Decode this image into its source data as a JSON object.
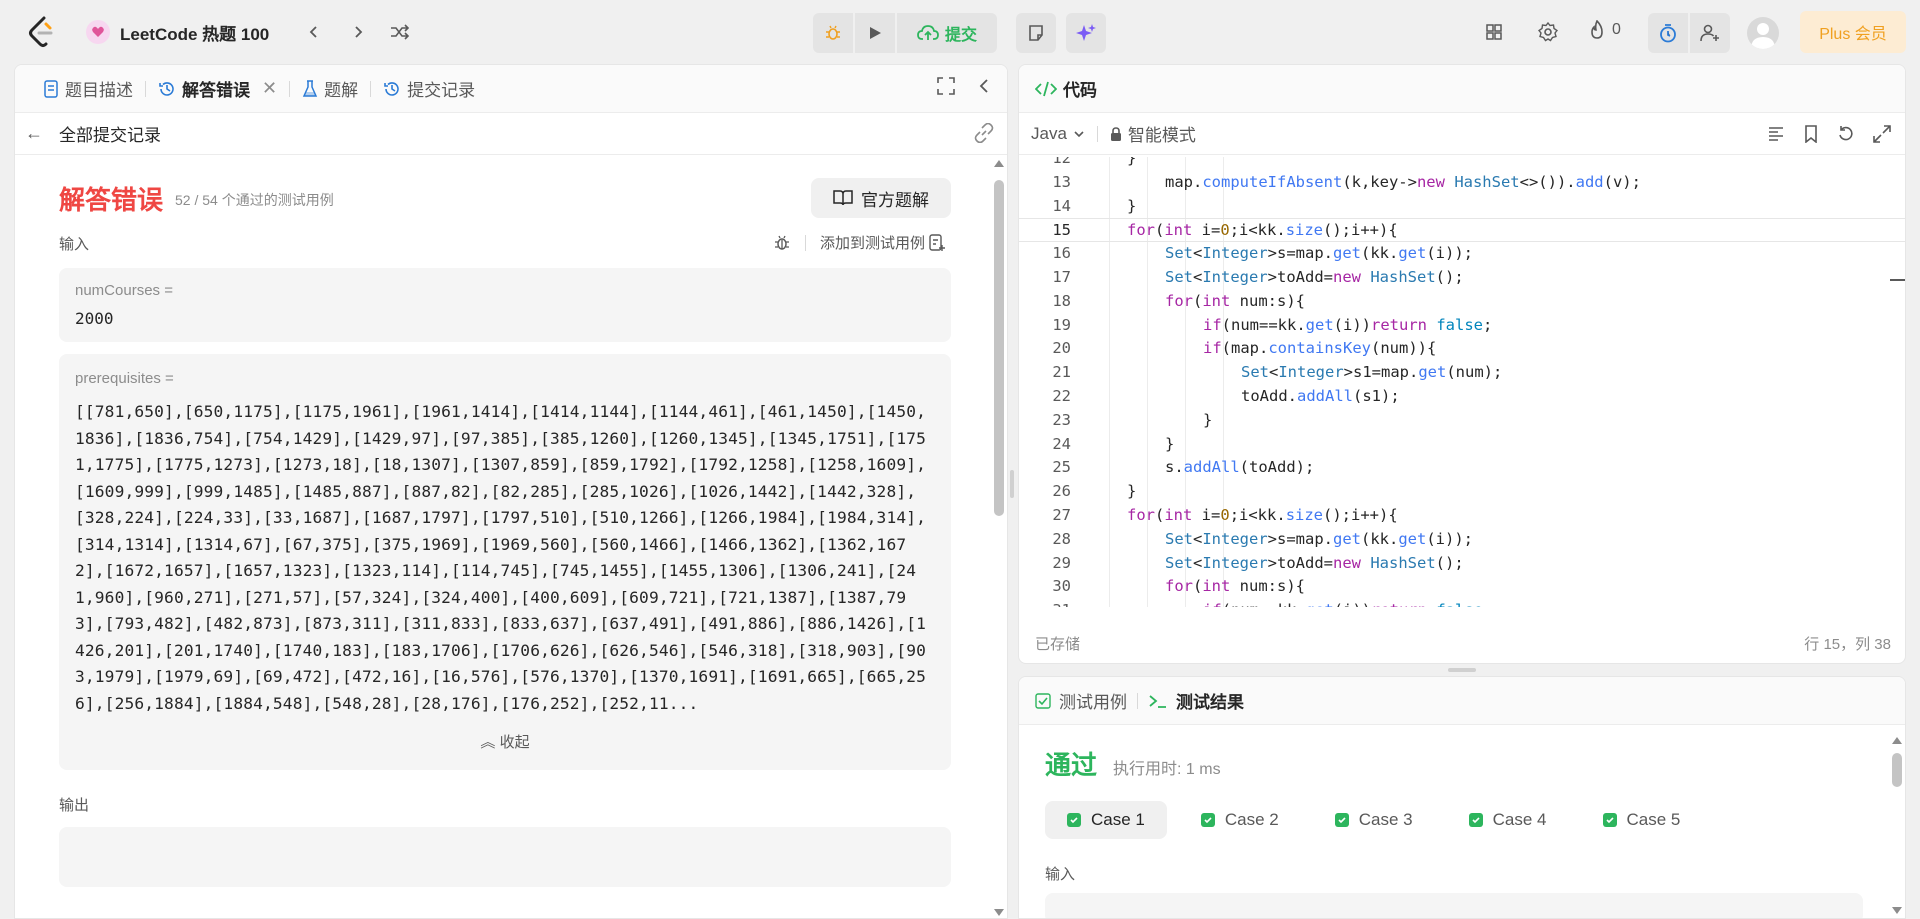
{
  "topbar": {
    "problem_list_title": "LeetCode 热题 100",
    "submit_label": "提交",
    "streak_count": "0",
    "plus_label": "Plus 会员"
  },
  "left_panel": {
    "tabs": [
      {
        "label": "题目描述"
      },
      {
        "label": "解答错误"
      },
      {
        "label": "题解"
      },
      {
        "label": "提交记录"
      }
    ],
    "back_label": "全部提交记录",
    "result_title": "解答错误",
    "result_subtitle": "52 / 54 个通过的测试用例",
    "official_solution_label": "官方题解",
    "input_label": "输入",
    "add_testcase_label": "添加到测试用例",
    "param1_name": "numCourses =",
    "param1_value": "2000",
    "param2_name": "prerequisites =",
    "param2_value": "[[781,650],[650,1175],[1175,1961],[1961,1414],[1414,1144],[1144,461],[461,1450],[1450,1836],[1836,754],[754,1429],[1429,97],[97,385],[385,1260],[1260,1345],[1345,1751],[1751,1775],[1775,1273],[1273,18],[18,1307],[1307,859],[859,1792],[1792,1258],[1258,1609],[1609,999],[999,1485],[1485,887],[887,82],[82,285],[285,1026],[1026,1442],[1442,328],[328,224],[224,33],[33,1687],[1687,1797],[1797,510],[510,1266],[1266,1984],[1984,314],[314,1314],[1314,67],[67,375],[375,1969],[1969,560],[560,1466],[1466,1362],[1362,1672],[1672,1657],[1657,1323],[1323,114],[114,745],[745,1455],[1455,1306],[1306,241],[241,960],[960,271],[271,57],[57,324],[324,400],[400,609],[609,721],[721,1387],[1387,793],[793,482],[482,873],[873,311],[311,833],[833,637],[637,491],[491,886],[886,1426],[1426,201],[201,1740],[1740,183],[183,1706],[1706,626],[626,546],[546,318],[318,903],[903,1979],[1979,69],[69,472],[472,16],[16,576],[576,1370],[1370,1691],[1691,665],[665,256],[256,1884],[1884,548],[548,28],[28,176],[176,252],[252,11...",
    "collapse_label": "收起",
    "output_label": "输出"
  },
  "code_panel": {
    "title": "代码",
    "language": "Java",
    "mode_label": "智能模式",
    "status_saved": "已存储",
    "cursor_pos": "行 15，列 38",
    "current_line": 15,
    "lines": [
      {
        "n": "12",
        "i": 2,
        "t": "}"
      },
      {
        "n": "13",
        "i": 3,
        "t": "map.computeIfAbsent(k,key->new HashSet<>()).add(v);"
      },
      {
        "n": "14",
        "i": 2,
        "t": "}"
      },
      {
        "n": "15",
        "i": 2,
        "t": "for(int i=0;i<kk.size();i++){"
      },
      {
        "n": "16",
        "i": 3,
        "t": "Set<Integer>s=map.get(kk.get(i));"
      },
      {
        "n": "17",
        "i": 3,
        "t": "Set<Integer>toAdd=new HashSet();"
      },
      {
        "n": "18",
        "i": 3,
        "t": "for(int num:s){"
      },
      {
        "n": "19",
        "i": 4,
        "t": "if(num==kk.get(i))return false;"
      },
      {
        "n": "20",
        "i": 4,
        "t": "if(map.containsKey(num)){"
      },
      {
        "n": "21",
        "i": 5,
        "t": "Set<Integer>s1=map.get(num);"
      },
      {
        "n": "22",
        "i": 5,
        "t": "toAdd.addAll(s1);"
      },
      {
        "n": "23",
        "i": 4,
        "t": "}"
      },
      {
        "n": "24",
        "i": 3,
        "t": "}"
      },
      {
        "n": "25",
        "i": 3,
        "t": "s.addAll(toAdd);"
      },
      {
        "n": "26",
        "i": 2,
        "t": "}"
      },
      {
        "n": "27",
        "i": 2,
        "t": "for(int i=0;i<kk.size();i++){"
      },
      {
        "n": "28",
        "i": 3,
        "t": "Set<Integer>s=map.get(kk.get(i));"
      },
      {
        "n": "29",
        "i": 3,
        "t": "Set<Integer>toAdd=new HashSet();"
      },
      {
        "n": "30",
        "i": 3,
        "t": "for(int num:s){"
      },
      {
        "n": "31",
        "i": 4,
        "t": "if(num==kk.get(i))return false;"
      }
    ]
  },
  "test_panel": {
    "tab_testcase": "测试用例",
    "tab_result": "测试结果",
    "pass_title": "通过",
    "run_time": "执行用时: 1 ms",
    "cases": [
      "Case 1",
      "Case 2",
      "Case 3",
      "Case 4",
      "Case 5"
    ],
    "input_label": "输入"
  },
  "colors": {
    "error": "#ef4743",
    "success": "#2db55d",
    "plus": "#f0a020"
  }
}
